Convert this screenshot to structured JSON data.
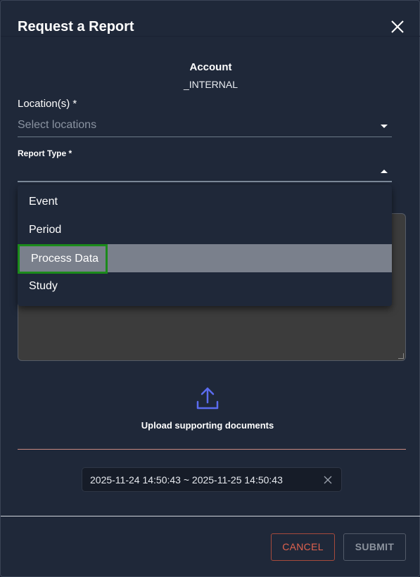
{
  "dialog": {
    "title": "Request a Report",
    "close_icon": "close-icon"
  },
  "account": {
    "label": "Account",
    "value": "_INTERNAL"
  },
  "locations": {
    "label": "Location(s) *",
    "placeholder": "Select locations"
  },
  "report_type": {
    "label": "Report Type *",
    "value": "",
    "options": [
      {
        "label": "Event"
      },
      {
        "label": "Period"
      },
      {
        "label": "Process Data",
        "highlighted": true
      },
      {
        "label": "Study"
      }
    ]
  },
  "upload": {
    "icon": "upload-icon",
    "label": "Upload supporting documents"
  },
  "date_range": {
    "value": "2025-11-24 14:50:43 ~ 2025-11-25 14:50:43"
  },
  "footer": {
    "cancel_label": "CANCEL",
    "submit_label": "SUBMIT"
  },
  "colors": {
    "background": "#1f2839",
    "accent_upload": "#5b6cf0",
    "cancel": "#e0624e",
    "highlight_option": "#7a808c",
    "focus_outline": "#1b8a1b"
  }
}
